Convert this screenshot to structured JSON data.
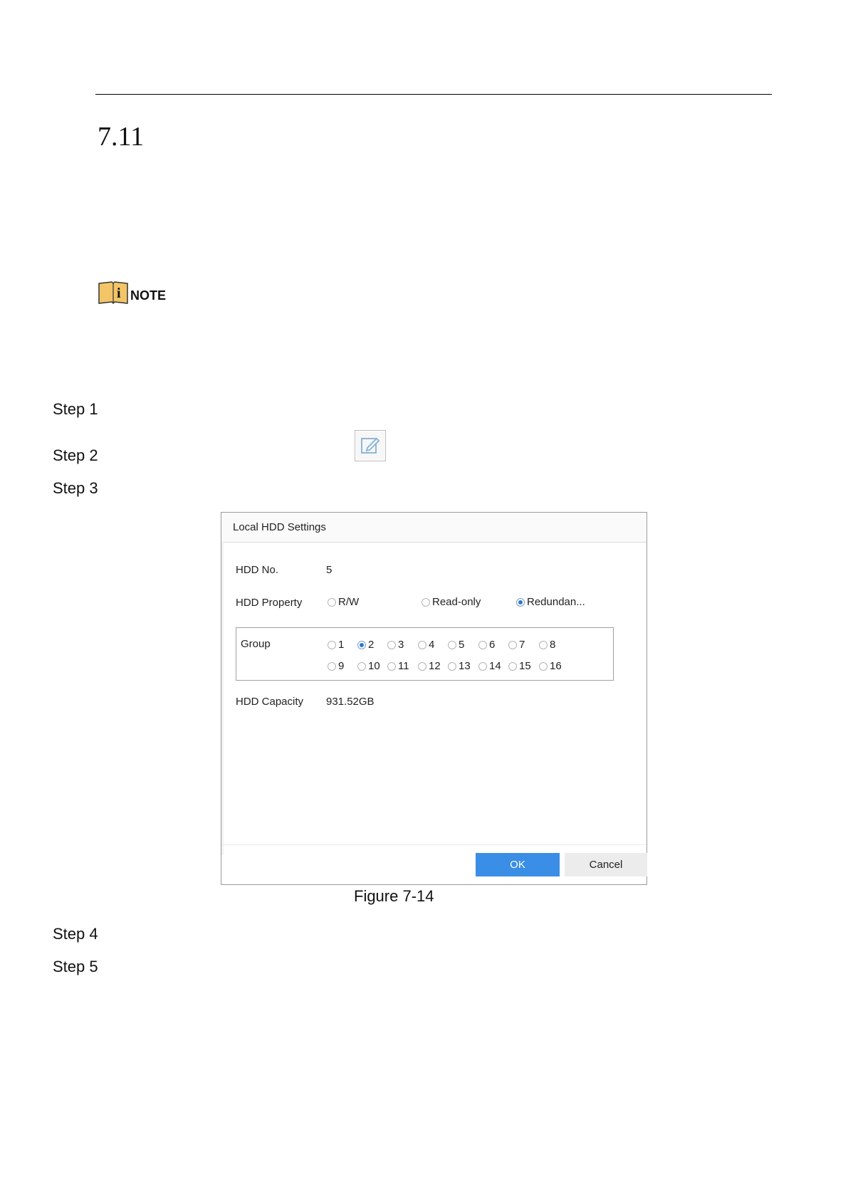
{
  "section": {
    "number": "7.11"
  },
  "note": {
    "label": "NOTE"
  },
  "steps": [
    "Step 1",
    "Step 2",
    "Step 3",
    "Step 4",
    "Step 5"
  ],
  "edit_icon": "edit-icon",
  "dialog": {
    "title": "Local HDD Settings",
    "hdd_no_label": "HDD No.",
    "hdd_no_value": "5",
    "property_label": "HDD Property",
    "property_options": [
      {
        "label": "R/W",
        "selected": false
      },
      {
        "label": "Read-only",
        "selected": false
      },
      {
        "label": "Redundan...",
        "selected": true
      }
    ],
    "group_label": "Group",
    "group_options": [
      "1",
      "2",
      "3",
      "4",
      "5",
      "6",
      "7",
      "8",
      "9",
      "10",
      "11",
      "12",
      "13",
      "14",
      "15",
      "16"
    ],
    "group_selected": "2",
    "capacity_label": "HDD Capacity",
    "capacity_value": "931.52GB",
    "ok_label": "OK",
    "cancel_label": "Cancel"
  },
  "caption": "Figure 7-14",
  "colors": {
    "accent": "#3a8ee6",
    "radio_selected": "#2a79d6"
  }
}
